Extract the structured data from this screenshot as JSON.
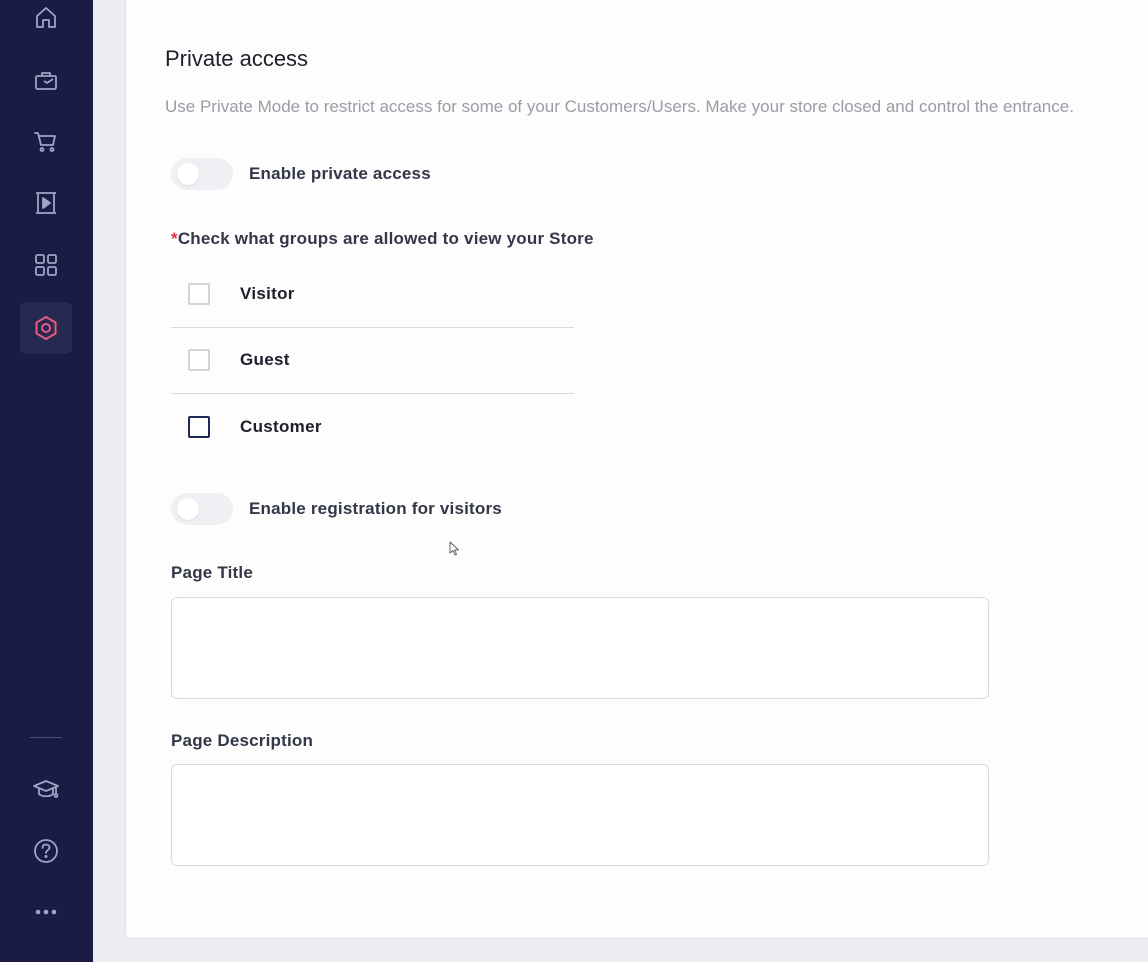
{
  "sidebar": {
    "items": [
      {
        "name": "home-icon"
      },
      {
        "name": "store-icon"
      },
      {
        "name": "cart-icon"
      },
      {
        "name": "media-icon"
      },
      {
        "name": "apps-icon"
      },
      {
        "name": "settings-icon",
        "active": true
      }
    ],
    "bottom_items": [
      {
        "name": "academy-icon"
      },
      {
        "name": "help-icon"
      },
      {
        "name": "more-icon"
      }
    ],
    "accent_color": "#e85a7a"
  },
  "section": {
    "title": "Private access",
    "description": "Use Private Mode to restrict access for some of your Customers/Users. Make your store closed and control the entrance."
  },
  "private_access_toggle": {
    "label": "Enable private access",
    "enabled": false
  },
  "groups": {
    "required_mark": "*",
    "label": "Check what groups are allowed to view your Store",
    "options": [
      {
        "label": "Visitor",
        "checked": false
      },
      {
        "label": "Guest",
        "checked": false
      },
      {
        "label": "Customer",
        "checked": false
      }
    ]
  },
  "registration_toggle": {
    "label": "Enable registration for visitors",
    "enabled": false
  },
  "page_title_field": {
    "label": "Page Title",
    "value": ""
  },
  "page_description_field": {
    "label": "Page Description",
    "value": ""
  }
}
